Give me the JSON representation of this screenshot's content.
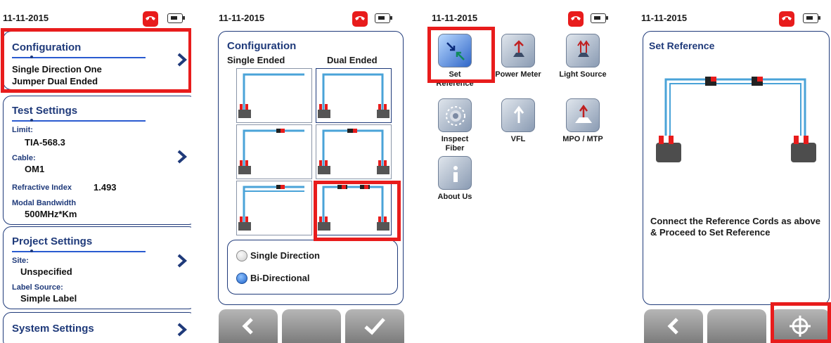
{
  "status": {
    "date": "11-11-2015"
  },
  "screen1": {
    "configuration": {
      "title": "Configuration",
      "line1": "Single Direction One",
      "line2": "Jumper Dual Ended"
    },
    "test_settings": {
      "title": "Test Settings",
      "limit_label": "Limit:",
      "limit_value": "TIA-568.3",
      "cable_label": "Cable:",
      "cable_value": "OM1",
      "refractive_label": "Refractive Index",
      "refractive_value": "1.493",
      "modal_label": "Modal Bandwidth",
      "modal_value": "500MHz*Km"
    },
    "project_settings": {
      "title": "Project Settings",
      "site_label": "Site:",
      "site_value": "Unspecified",
      "label_source_label": "Label Source:",
      "label_source_value": "Simple Label"
    },
    "system_settings": {
      "title": "System Settings"
    }
  },
  "screen2": {
    "title": "Configuration",
    "col_single": "Single Ended",
    "col_dual": "Dual Ended",
    "options": [
      "Single Direction",
      "Bi-Directional"
    ],
    "selected_option": "Bi-Directional"
  },
  "screen3": {
    "apps": [
      {
        "label": "Set Reference",
        "icon": "set-reference-icon"
      },
      {
        "label": "Power Meter",
        "icon": "power-meter-icon"
      },
      {
        "label": "Light Source",
        "icon": "light-source-icon"
      },
      {
        "label": "Inspect",
        "label2": "Fiber",
        "icon": "inspect-fiber-icon"
      },
      {
        "label": "VFL",
        "icon": "vfl-icon"
      },
      {
        "label": "MPO / MTP",
        "icon": "mpo-mtp-icon"
      },
      {
        "label": "About Us",
        "icon": "about-icon"
      }
    ]
  },
  "screen4": {
    "title": "Set Reference",
    "message": "Connect the Reference Cords as above & Proceed to Set Reference"
  },
  "colors": {
    "highlight": "#e81c1c",
    "accent": "#1f3a7a",
    "fiber": "#4aa3d8"
  }
}
